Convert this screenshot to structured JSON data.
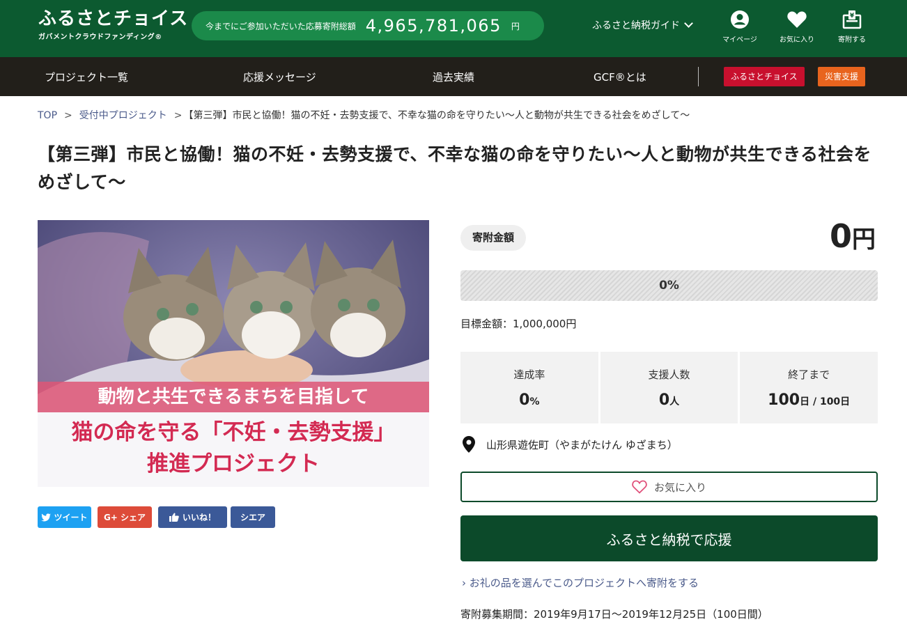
{
  "header": {
    "logo_main": "ふるさとチョイス",
    "logo_sub": "ガバメントクラウドファンディング®",
    "total_label": "今までにご参加いただいた応募寄附総額",
    "total_amount": "4,965,781,065",
    "total_unit": "円",
    "guide_label": "ふるさと納税ガイド",
    "icons": [
      {
        "name": "mypage",
        "label": "マイページ"
      },
      {
        "name": "favorites",
        "label": "お気に入り"
      },
      {
        "name": "donate",
        "label": "寄附する"
      }
    ]
  },
  "nav": {
    "items": [
      "プロジェクト一覧",
      "応援メッセージ",
      "過去実績",
      "GCF®とは"
    ],
    "badges": [
      {
        "label": "ふるさとチョイス",
        "color": "#c8102e"
      },
      {
        "label": "災害支援",
        "color": "#e8641e"
      }
    ]
  },
  "breadcrumb": {
    "items": [
      "TOP",
      "受付中プロジェクト"
    ],
    "separator": ">",
    "current": "【第三弾】市民と協働！猫の不妊・去勢支援で、不幸な猫の命を守りたい～人と動物が共生できる社会をめざして～"
  },
  "project": {
    "title": "【第三弾】市民と協働！猫の不妊・去勢支援で、不幸な猫の命を守りたい～人と動物が共生できる社会をめざして～",
    "image_text": {
      "line1": "動物と共生できるまちを目指して",
      "line2": "猫の命を守る「不妊・去勢支援」",
      "line3": "推進プロジェクト"
    },
    "share": [
      {
        "label": "ツイート",
        "color": "#1da1f2"
      },
      {
        "label": "G+ シェア",
        "color": "#dd4b39"
      },
      {
        "label": "いいね！",
        "color": "#3b5998"
      },
      {
        "label": "シエア",
        "color": "#3b5998"
      }
    ]
  },
  "funding": {
    "amount_label": "寄附金額",
    "amount_value": "0",
    "amount_unit": "円",
    "progress_percent": 0,
    "progress_label": "0%",
    "goal_text": "目標金額：1,000,000円",
    "stats": [
      {
        "label": "達成率",
        "value": "0",
        "unit": "%"
      },
      {
        "label": "支援人数",
        "value": "0",
        "unit": "人"
      },
      {
        "label": "終了まで",
        "value": "100",
        "unit": "日 / 100日"
      }
    ],
    "location": "山形県遊佐町（やまがたけん ゆざまち）",
    "favorite_label": "お気に入り",
    "support_label": "ふるさと納税で応援",
    "gift_link": "› お礼の品を選んでこのプロジェクトへ寄附をする",
    "period": "寄附募集期間：2019年9月17日～2019年12月25日（100日間）"
  },
  "colors": {
    "header_green": "#0c5a30",
    "pill_green": "#1b8a4a",
    "nav_dark": "#221f1a",
    "button_green": "#0c4a2a",
    "heart_pink": "#e0507a"
  }
}
